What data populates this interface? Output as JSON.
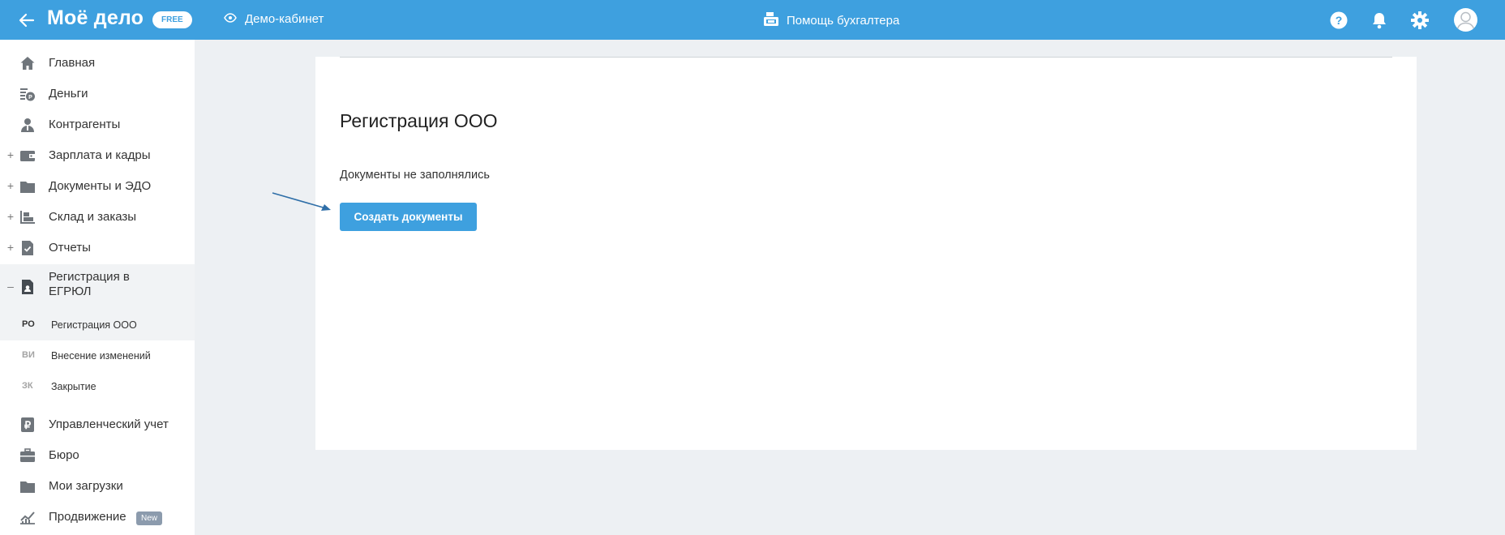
{
  "topbar": {
    "logo": "Моё дело",
    "badge": "FREE",
    "demo_label": "Демо-кабинет",
    "helper_label": "Помощь бухгалтера",
    "icons": [
      "back-arrow-icon",
      "eye-icon",
      "cash-register-icon",
      "help-icon",
      "bell-icon",
      "gear-icon",
      "avatar-icon"
    ],
    "color": "#3ea0df"
  },
  "sidebar": {
    "items": [
      {
        "label": "Главная",
        "icon": "home-icon"
      },
      {
        "label": "Деньги",
        "icon": "money-icon"
      },
      {
        "label": "Контрагенты",
        "icon": "contractor-icon"
      },
      {
        "label": "Зарплата и кадры",
        "icon": "wallet-icon",
        "expander": "+"
      },
      {
        "label": "Документы и ЭДО",
        "icon": "folder-icon",
        "expander": "+"
      },
      {
        "label": "Склад и заказы",
        "icon": "warehouse-icon",
        "expander": "+"
      },
      {
        "label": "Отчеты",
        "icon": "report-icon",
        "expander": "+"
      },
      {
        "label_line1": "Регистрация в",
        "label_line2": "ЕГРЮЛ",
        "icon": "registration-icon",
        "expander": "–"
      },
      {
        "label": "Управленческий учет",
        "icon": "ruble-icon"
      },
      {
        "label": "Бюро",
        "icon": "briefcase-icon"
      },
      {
        "label": "Мои загрузки",
        "icon": "downloads-folder-icon"
      },
      {
        "label": "Продвижение",
        "icon": "promotion-icon",
        "badge": "New"
      }
    ],
    "subitems": [
      {
        "abbr": "РО",
        "label": "Регистрация ООО"
      },
      {
        "abbr": "ВИ",
        "label": "Внесение изменений"
      },
      {
        "abbr": "ЗК",
        "label": "Закрытие"
      }
    ]
  },
  "main": {
    "title": "Регистрация ООО",
    "status": "Документы не заполнялись",
    "create_button": "Создать документы"
  }
}
